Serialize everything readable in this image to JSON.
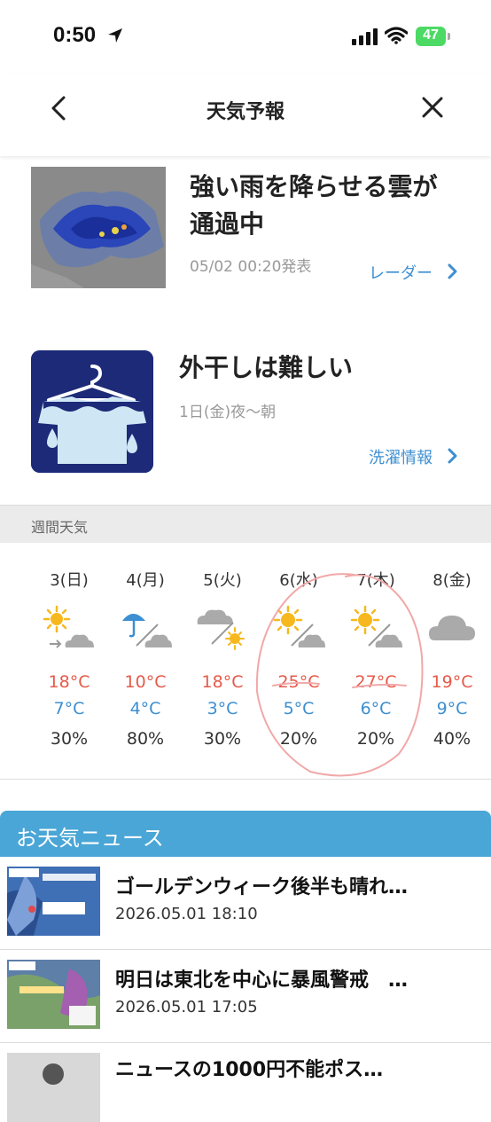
{
  "status_bar": {
    "time": "0:50",
    "battery": "47"
  },
  "nav": {
    "title": "天気予報"
  },
  "radar_card": {
    "title_line1": "強い雨を降らせる雲が",
    "title_line2": "通過中",
    "timestamp": "05/02 00:20発表",
    "link_label": "レーダー"
  },
  "laundry_card": {
    "title": "外干しは難しい",
    "period": "1日(金)夜〜朝",
    "link_label": "洗濯情報"
  },
  "weekly": {
    "header": "週間天気",
    "days": [
      {
        "label": "3(日)",
        "icon": "sun-then-cloud-icon",
        "high": "18°C",
        "low": "7°C",
        "pop": "30%"
      },
      {
        "label": "4(月)",
        "icon": "umbrella-then-cloud-icon",
        "high": "10°C",
        "low": "4°C",
        "pop": "80%"
      },
      {
        "label": "5(火)",
        "icon": "cloud-then-sun-icon",
        "high": "18°C",
        "low": "3°C",
        "pop": "30%"
      },
      {
        "label": "6(水)",
        "icon": "sun-then-cloud-icon",
        "high": "25°C",
        "low": "5°C",
        "pop": "20%"
      },
      {
        "label": "7(木)",
        "icon": "sun-then-cloud-icon",
        "high": "27°C",
        "low": "6°C",
        "pop": "20%"
      },
      {
        "label": "8(金)",
        "icon": "cloud-icon",
        "high": "19°C",
        "low": "9°C",
        "pop": "40%"
      }
    ]
  },
  "news": {
    "header": "お天気ニュース",
    "items": [
      {
        "title": "ゴールデンウィーク後半も晴れ…",
        "date": "2026.05.01 18:10"
      },
      {
        "title": "明日は東北を中心に暴風警戒　…",
        "date": "2026.05.01 17:05"
      },
      {
        "title": "ニュースの1000円不能ポス…",
        "date": ""
      }
    ]
  },
  "colors": {
    "accent_blue": "#3d8fd1",
    "high_temp": "#e65a4a",
    "news_header": "#4aa6d6"
  }
}
